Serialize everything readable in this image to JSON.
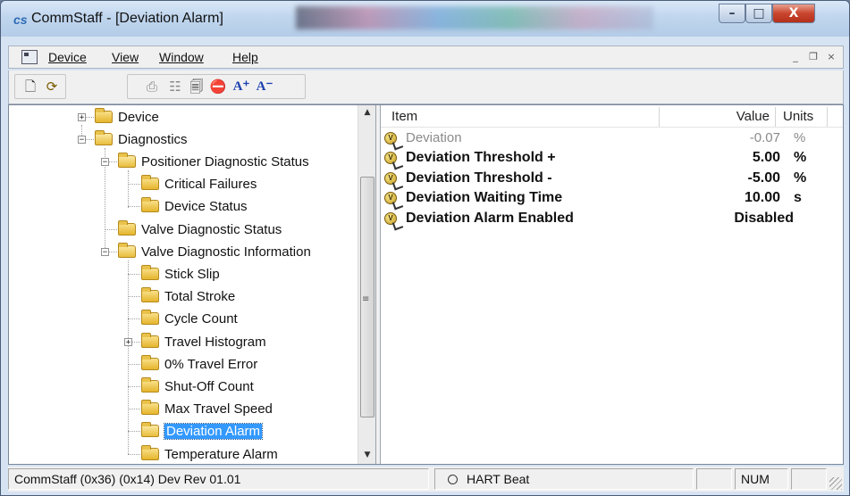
{
  "window": {
    "app_icon": "cs",
    "title": "CommStaff - [Deviation Alarm]",
    "controls": {
      "minimize": "–",
      "maximize": "□",
      "close": "X"
    }
  },
  "menu": {
    "items": [
      "Device",
      "View",
      "Window",
      "Help"
    ],
    "mdi_controls": {
      "minimize": "_",
      "restore": "❐",
      "close": "×"
    }
  },
  "toolbar": {
    "buttons": [
      "new-icon",
      "refresh-icon",
      "print-icon",
      "tree-icon",
      "properties-icon",
      "stop-icon",
      "font-increase-icon",
      "font-decrease-icon"
    ],
    "font_increase": "A⁺",
    "font_decrease": "A⁻"
  },
  "tree": {
    "nodes": [
      {
        "label": "Device",
        "expander": "+"
      },
      {
        "label": "Diagnostics",
        "expander": "−"
      },
      {
        "label": "Positioner Diagnostic Status",
        "expander": "−"
      },
      {
        "label": "Critical Failures"
      },
      {
        "label": "Device Status"
      },
      {
        "label": "Valve Diagnostic Status"
      },
      {
        "label": "Valve Diagnostic Information",
        "expander": "−"
      },
      {
        "label": "Stick Slip"
      },
      {
        "label": "Total Stroke"
      },
      {
        "label": "Cycle Count"
      },
      {
        "label": "Travel Histogram",
        "expander": "+"
      },
      {
        "label": "0% Travel Error"
      },
      {
        "label": "Shut-Off Count"
      },
      {
        "label": "Max Travel Speed"
      },
      {
        "label": "Deviation Alarm",
        "selected": true
      },
      {
        "label": "Temperature Alarm"
      }
    ],
    "scroll_up": "▲",
    "scroll_down": "▼",
    "scroll_grip": "≡"
  },
  "list": {
    "columns": {
      "item": "Item",
      "value": "Value",
      "units": "Units"
    },
    "rows": [
      {
        "name": "Deviation",
        "value": "-0.07",
        "unit": "%",
        "style": "grey"
      },
      {
        "name": "Deviation Threshold +",
        "value": "5.00",
        "unit": "%",
        "style": "bold"
      },
      {
        "name": "Deviation Threshold -",
        "value": "-5.00",
        "unit": "%",
        "style": "bold"
      },
      {
        "name": "Deviation Waiting Time",
        "value": "10.00",
        "unit": "s",
        "style": "bold"
      },
      {
        "name": "Deviation Alarm Enabled",
        "value": "Disabled",
        "unit": "",
        "style": "bold"
      }
    ]
  },
  "statusbar": {
    "device_info": "CommStaff  (0x36)  (0x14) Dev Rev 01.01",
    "hart_beat": "HART Beat",
    "num": "NUM"
  }
}
